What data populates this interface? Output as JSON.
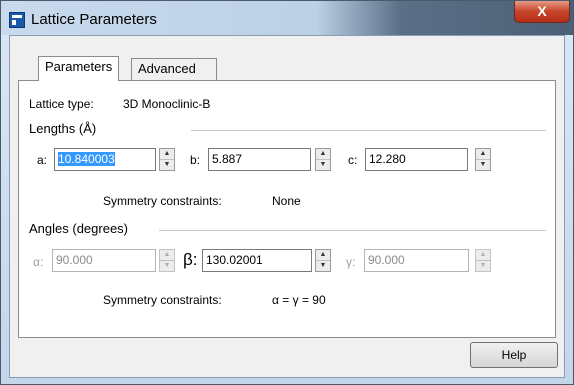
{
  "window": {
    "title": "Lattice Parameters",
    "close_label": "X"
  },
  "tabs": [
    {
      "label": "Parameters"
    },
    {
      "label": "Advanced"
    }
  ],
  "lattice": {
    "type_label": "Lattice type:",
    "type_value": "3D Monoclinic-B"
  },
  "lengths": {
    "group_label": "Lengths (Å)",
    "a": {
      "label": "a:",
      "value": "10.840003"
    },
    "b": {
      "label": "b:",
      "value": "5.887"
    },
    "c": {
      "label": "c:",
      "value": "12.280"
    },
    "constraints_label": "Symmetry constraints:",
    "constraints_value": "None"
  },
  "angles": {
    "group_label": "Angles (degrees)",
    "alpha": {
      "label": "α:",
      "value": "90.000",
      "enabled": false
    },
    "beta": {
      "label": "β:",
      "value": "130.02001",
      "enabled": true
    },
    "gamma": {
      "label": "γ:",
      "value": "90.000",
      "enabled": false
    },
    "constraints_label": "Symmetry constraints:",
    "constraints_value": "α = γ = 90"
  },
  "buttons": {
    "help": "Help"
  },
  "icons": {
    "app": "lattice-app-icon",
    "spinner_up": "spin-up-arrow",
    "spinner_down": "spin-down-arrow"
  },
  "colors": {
    "selection": "#3399ff",
    "close_button": "#c7442a"
  }
}
